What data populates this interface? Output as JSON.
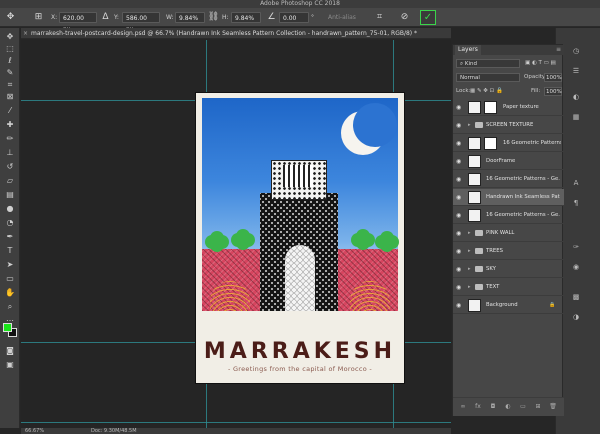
{
  "app": {
    "title": "Adobe Photoshop CC 2018"
  },
  "options_bar": {
    "x_label": "X:",
    "x_value": "620.00 px",
    "y_label": "Y:",
    "y_value": "586.00 px",
    "w_label": "W:",
    "w_value": "9.84%",
    "h_label": "H:",
    "h_value": "9.84%",
    "angle_value": "0.00",
    "degree_unit": "°",
    "antialias_label": "Anti-alias"
  },
  "document": {
    "tab_title": "marrakesh-travel-postcard-design.psd @ 66.7% (Handrawn Ink Seamless Pattern Collection - handrawn_pattern_75-01, RGB/8) *",
    "zoom": "66.67%",
    "doc_info": "Doc: 9.30M/48.5M"
  },
  "postcard": {
    "title": "MARRAKESH",
    "subtitle": "- Greetings from the capital of Morocco -"
  },
  "colors": {
    "foreground": "#19e619",
    "background": "#111111",
    "commit_accent": "#3bd34b",
    "guide": "#2e8f95"
  },
  "layers_panel": {
    "tab_label": "Layers",
    "filter_value": "Kind",
    "blend_mode": "Normal",
    "opacity_label": "Opacity:",
    "opacity_value": "100%",
    "lock_label": "Lock:",
    "fill_label": "Fill:",
    "fill_value": "100%",
    "layers": [
      {
        "name": "Paper texture",
        "kind": "masked"
      },
      {
        "name": "SCREEN TEXTURE",
        "kind": "group"
      },
      {
        "name": "16 Geometric Patterns - ...",
        "kind": "masked"
      },
      {
        "name": "DoorFrame",
        "kind": "layer"
      },
      {
        "name": "16 Geometric Patterns - Ge...",
        "kind": "layer"
      },
      {
        "name": "Handrawn Ink Seamless Pat...",
        "kind": "layer",
        "selected": true
      },
      {
        "name": "16 Geometric Patterns - Ge...",
        "kind": "layer"
      },
      {
        "name": "PINK WALL",
        "kind": "group"
      },
      {
        "name": "TREES",
        "kind": "group"
      },
      {
        "name": "SKY",
        "kind": "group"
      },
      {
        "name": "TEXT",
        "kind": "group"
      },
      {
        "name": "Background",
        "kind": "background"
      }
    ]
  },
  "icons": {
    "move": "move-icon",
    "marquee": "marquee-icon",
    "lasso": "lasso-icon",
    "quick_select": "quick-select-icon",
    "crop": "crop-icon",
    "eyedropper": "eyedropper-icon",
    "heal": "healing-icon",
    "brush": "brush-icon",
    "stamp": "clone-stamp-icon",
    "history": "history-brush-icon",
    "eraser": "eraser-icon",
    "gradient": "gradient-icon",
    "blur": "blur-icon",
    "dodge": "dodge-icon",
    "pen": "pen-icon",
    "type": "type-icon",
    "path_select": "path-select-icon",
    "shape": "shape-icon",
    "hand": "hand-icon",
    "zoom": "zoom-icon",
    "more": "more-icon",
    "quick_mask": "quick-mask-icon",
    "screen_mode": "screen-mode-icon"
  }
}
